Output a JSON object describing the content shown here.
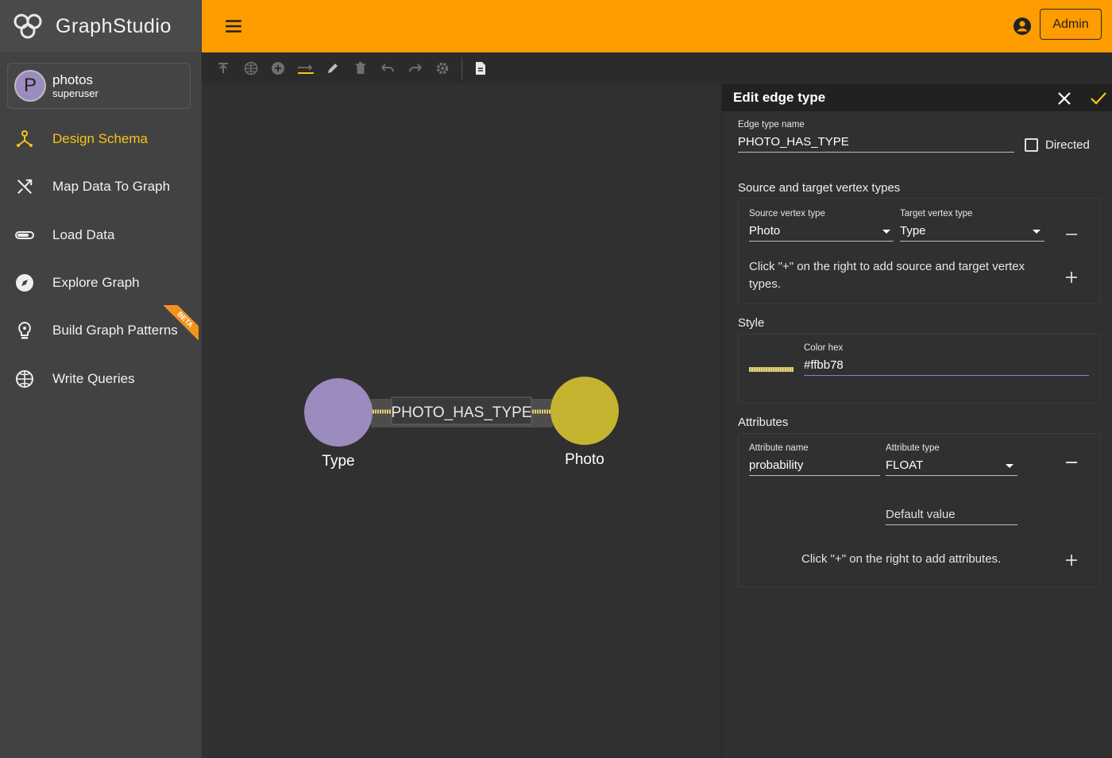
{
  "app": {
    "brand": "GraphStudio"
  },
  "user": {
    "initial": "P",
    "name": "photos",
    "role": "superuser"
  },
  "nav": [
    {
      "label": "Design Schema",
      "icon": "schema-icon",
      "active": true
    },
    {
      "label": "Map Data To Graph",
      "icon": "shuffle-icon",
      "active": false
    },
    {
      "label": "Load Data",
      "icon": "load-icon",
      "active": false
    },
    {
      "label": "Explore Graph",
      "icon": "compass-icon",
      "active": false
    },
    {
      "label": "Build Graph Patterns",
      "icon": "lightbulb-icon",
      "active": false,
      "badge": "BETA"
    },
    {
      "label": "Write Queries",
      "icon": "globe-icon",
      "active": false
    }
  ],
  "header": {
    "admin_label": "Admin"
  },
  "graph": {
    "edge_label": "PHOTO_HAS_TYPE",
    "nodes": [
      {
        "label": "Type",
        "color": "#9c8bbf"
      },
      {
        "label": "Photo",
        "color": "#c4b430"
      }
    ],
    "edge_color": "#ffbb78"
  },
  "panel": {
    "title": "Edit edge type",
    "edge_type_name_label": "Edge type name",
    "edge_type_name": "PHOTO_HAS_TYPE",
    "directed_label": "Directed",
    "source_target_title": "Source and target vertex types",
    "source_label": "Source vertex type",
    "source_value": "Photo",
    "target_label": "Target vertex type",
    "target_value": "Type",
    "source_target_hint": "Click \"+\" on the right to add source and target vertex types.",
    "style_title": "Style",
    "color_hex_label": "Color hex",
    "color_hex": "#ffbb78",
    "attributes_title": "Attributes",
    "attr_name_label": "Attribute name",
    "attr_name": "probability",
    "attr_type_label": "Attribute type",
    "attr_type": "FLOAT",
    "default_value_placeholder": "Default value",
    "attributes_hint": "Click \"+\" on the right to add attributes."
  },
  "colors": {
    "accent": "#ff9c00",
    "active_nav": "#f5c518"
  }
}
